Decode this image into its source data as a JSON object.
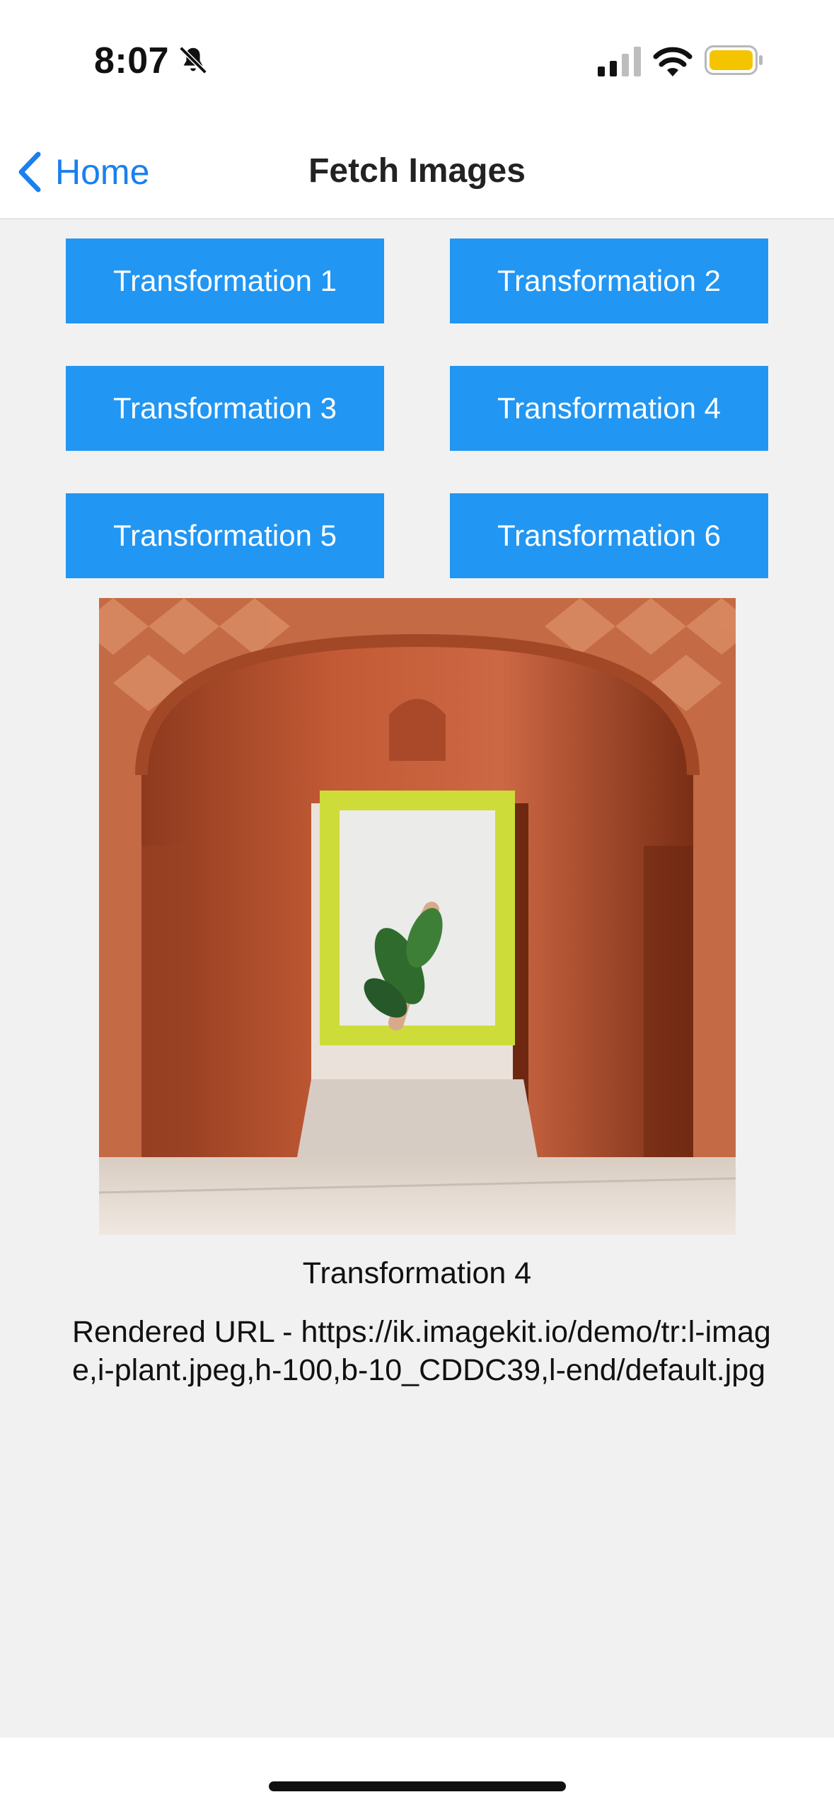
{
  "status_bar": {
    "time": "8:07",
    "icons": [
      "bell-slash-icon",
      "cellular-signal-icon",
      "wifi-icon",
      "battery-icon"
    ],
    "battery_color": "#f5c400"
  },
  "nav": {
    "back_label": "Home",
    "title": "Fetch Images"
  },
  "buttons": [
    {
      "label": "Transformation 1"
    },
    {
      "label": "Transformation 2"
    },
    {
      "label": "Transformation 3"
    },
    {
      "label": "Transformation 4"
    },
    {
      "label": "Transformation 5"
    },
    {
      "label": "Transformation 6"
    }
  ],
  "image": {
    "caption": "Transformation 4",
    "url_text": "Rendered URL - https://ik.imagekit.io/demo/tr:l-image,i-plant.jpeg,h-100,b-10_CDDC39,l-end/default.jpg",
    "border_color": "#cddc39"
  },
  "colors": {
    "accent": "#1a7ff0",
    "button": "#2196f3",
    "background": "#f1f1f1"
  }
}
